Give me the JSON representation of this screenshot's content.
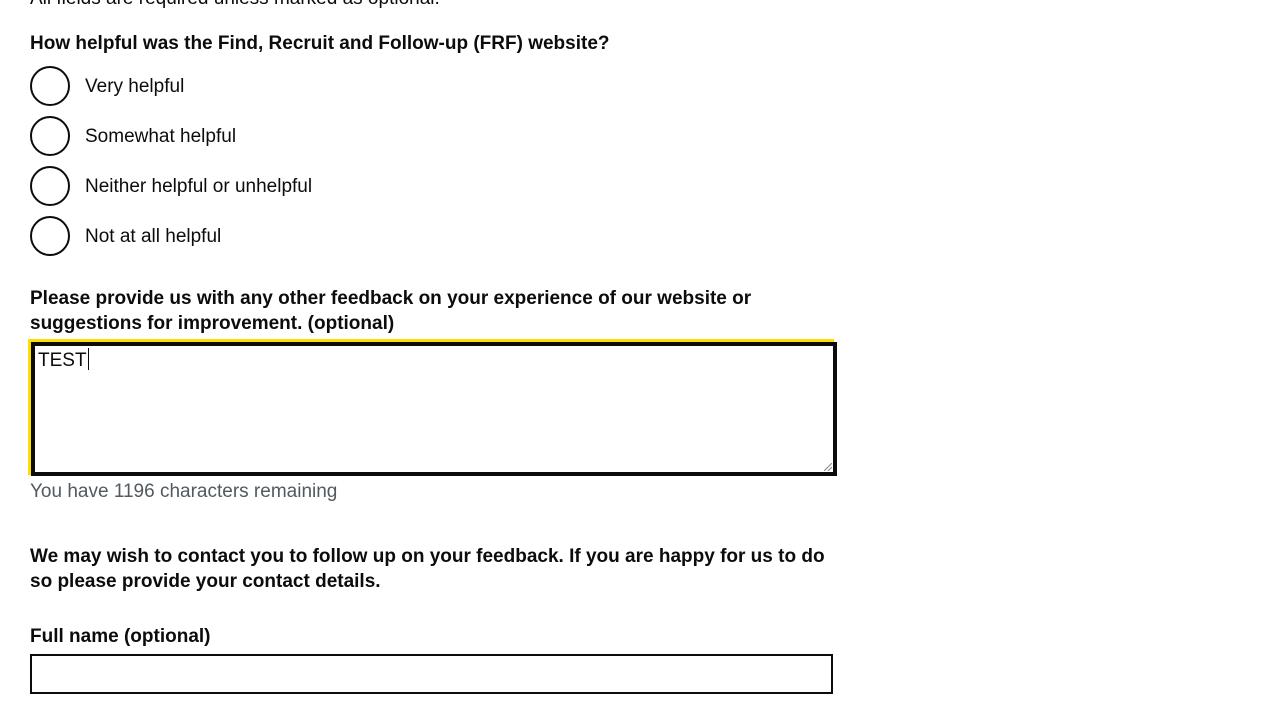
{
  "form": {
    "intro": "All fields are required unless marked as optional.",
    "helpfulness": {
      "question": "How helpful was the Find, Recruit and Follow-up (FRF) website?",
      "options": [
        "Very helpful",
        "Somewhat helpful",
        "Neither helpful or unhelpful",
        "Not at all helpful"
      ]
    },
    "feedback": {
      "question": "Please provide us with any other feedback on your experience of our website or suggestions for improvement. (optional)",
      "value": "TEST",
      "hint": "You have 1196 characters remaining"
    },
    "contact": {
      "prompt": "We may wish to contact you to follow up on your feedback. If you are happy for us to do so please provide your contact details."
    },
    "full_name": {
      "label": "Full name (optional)",
      "value": ""
    }
  },
  "colors": {
    "text": "#0b0c0c",
    "hint": "#505a5f",
    "focus": "#ffdd00"
  }
}
